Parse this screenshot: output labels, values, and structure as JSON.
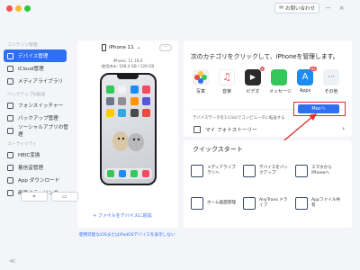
{
  "topbar": {
    "inquiry_label": "お問い合わせ",
    "minimize": "−",
    "close": "×"
  },
  "sidebar": {
    "sections": [
      {
        "label": "コンテンツ管理",
        "items": [
          "デバイス管理",
          "iCloud管理",
          "メディアライブラリ"
        ]
      },
      {
        "label": "バックアップ&転送",
        "items": [
          "フォンスイッチャー",
          "バックアップ管理",
          "ソーシャルアプリの管理"
        ]
      },
      {
        "label": "ユーティリティ",
        "items": [
          "HEIC変換",
          "着信音管理",
          "App ダウンロード",
          "画面ミラーリング"
        ]
      }
    ],
    "active_item": "デバイス管理",
    "collapse_icon": "≪"
  },
  "device": {
    "name": "iPhone 11",
    "info_line1": "iPhone, 11 16.0",
    "info_line2": "使用済み: 108.4 GB / 128 GB",
    "more_label": "···",
    "add_files_link": "+ ファイルをデバイスに追加",
    "screenshot_label": "⌖",
    "monitor_label": "▭"
  },
  "footer_link": "使用可能なiOSまたはiPadOSデバイスを表示しない",
  "categories": {
    "title": "次のカテゴリをクリックして、iPhoneを管理します。",
    "items": [
      {
        "label": "写真",
        "badge": "",
        "color": "#f2f2f2"
      },
      {
        "label": "音楽",
        "badge": "",
        "color": "#fa4a60"
      },
      {
        "label": "ビデオ",
        "badge": "5",
        "color": "#2b2b2b"
      },
      {
        "label": "メッセージ",
        "badge": "",
        "color": "#35c759"
      },
      {
        "label": "Apps",
        "badge": "82",
        "color": "#1c8cf2"
      },
      {
        "label": "その他",
        "badge": "",
        "color": "#eef1f5"
      }
    ],
    "export_desc": "デバイスデータを1-Clickでコンピュータに転送する",
    "export_button": "Macへ"
  },
  "story": {
    "label": "マイ フォトストーリー",
    "chevron": "›"
  },
  "quickstart": {
    "title": "クイックスタート",
    "items": [
      "メディアライブラリへ",
      "デバイスをバックアップ",
      "スマホから iPhoneへ",
      "ホーム画面管理",
      "AnyTrans ドライブ",
      "Appファイル共有"
    ]
  },
  "colors": {
    "accent": "#2f6ff2",
    "highlight": "#e2302d"
  }
}
